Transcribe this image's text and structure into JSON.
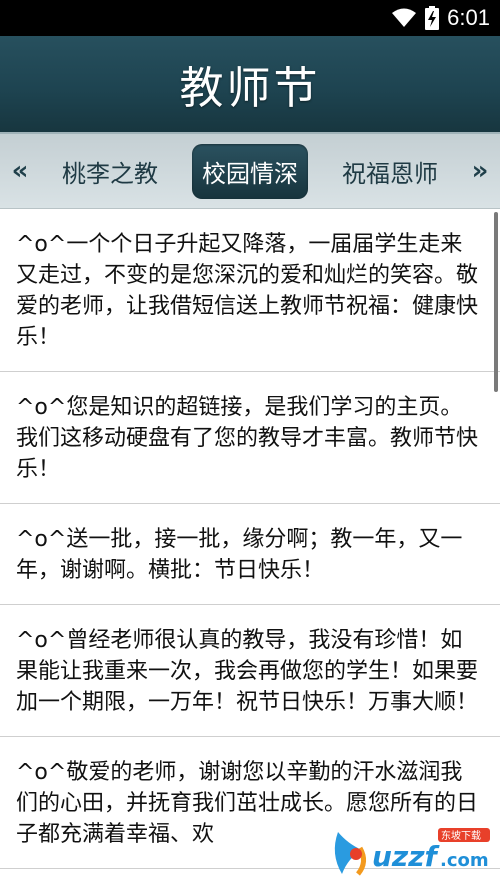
{
  "status_bar": {
    "time": "6:01",
    "icons": [
      "wifi-icon",
      "battery-charging-icon"
    ]
  },
  "header": {
    "title": "教师节"
  },
  "tabs": {
    "prev_icon": "«",
    "next_icon": "»",
    "items": [
      {
        "label": "桃李之教",
        "active": false
      },
      {
        "label": "校园情深",
        "active": true
      },
      {
        "label": "祝福恩师",
        "active": false
      }
    ]
  },
  "messages": [
    "^o^一个个日子升起又降落，一届届学生走来又走过，不变的是您深沉的爱和灿烂的笑容。敬爱的老师，让我借短信送上教师节祝福：健康快乐！",
    "^o^您是知识的超链接，是我们学习的主页。我们这移动硬盘有了您的教导才丰富。教师节快乐！",
    "^o^送一批，接一批，缘分啊；教一年，又一年，谢谢啊。横批：节日快乐！",
    "^o^曾经老师很认真的教导，我没有珍惜！如果能让我重来一次，我会再做您的学生！如果要加一个期限，一万年！祝节日快乐！万事大顺！",
    "^o^敬爱的老师，谢谢您以辛勤的汗水滋润我们的心田，并抚育我们茁壮成长。愿您所有的日子都充满着幸福、欢"
  ],
  "watermark": {
    "brand": "uzzf.com",
    "tagline": "东坡下载"
  },
  "colors": {
    "header_bg": "#1e4451",
    "tab_bar_bg": "#d3dcdf",
    "active_tab_bg": "#1f3f4a",
    "status_bar_bg": "#000000"
  }
}
